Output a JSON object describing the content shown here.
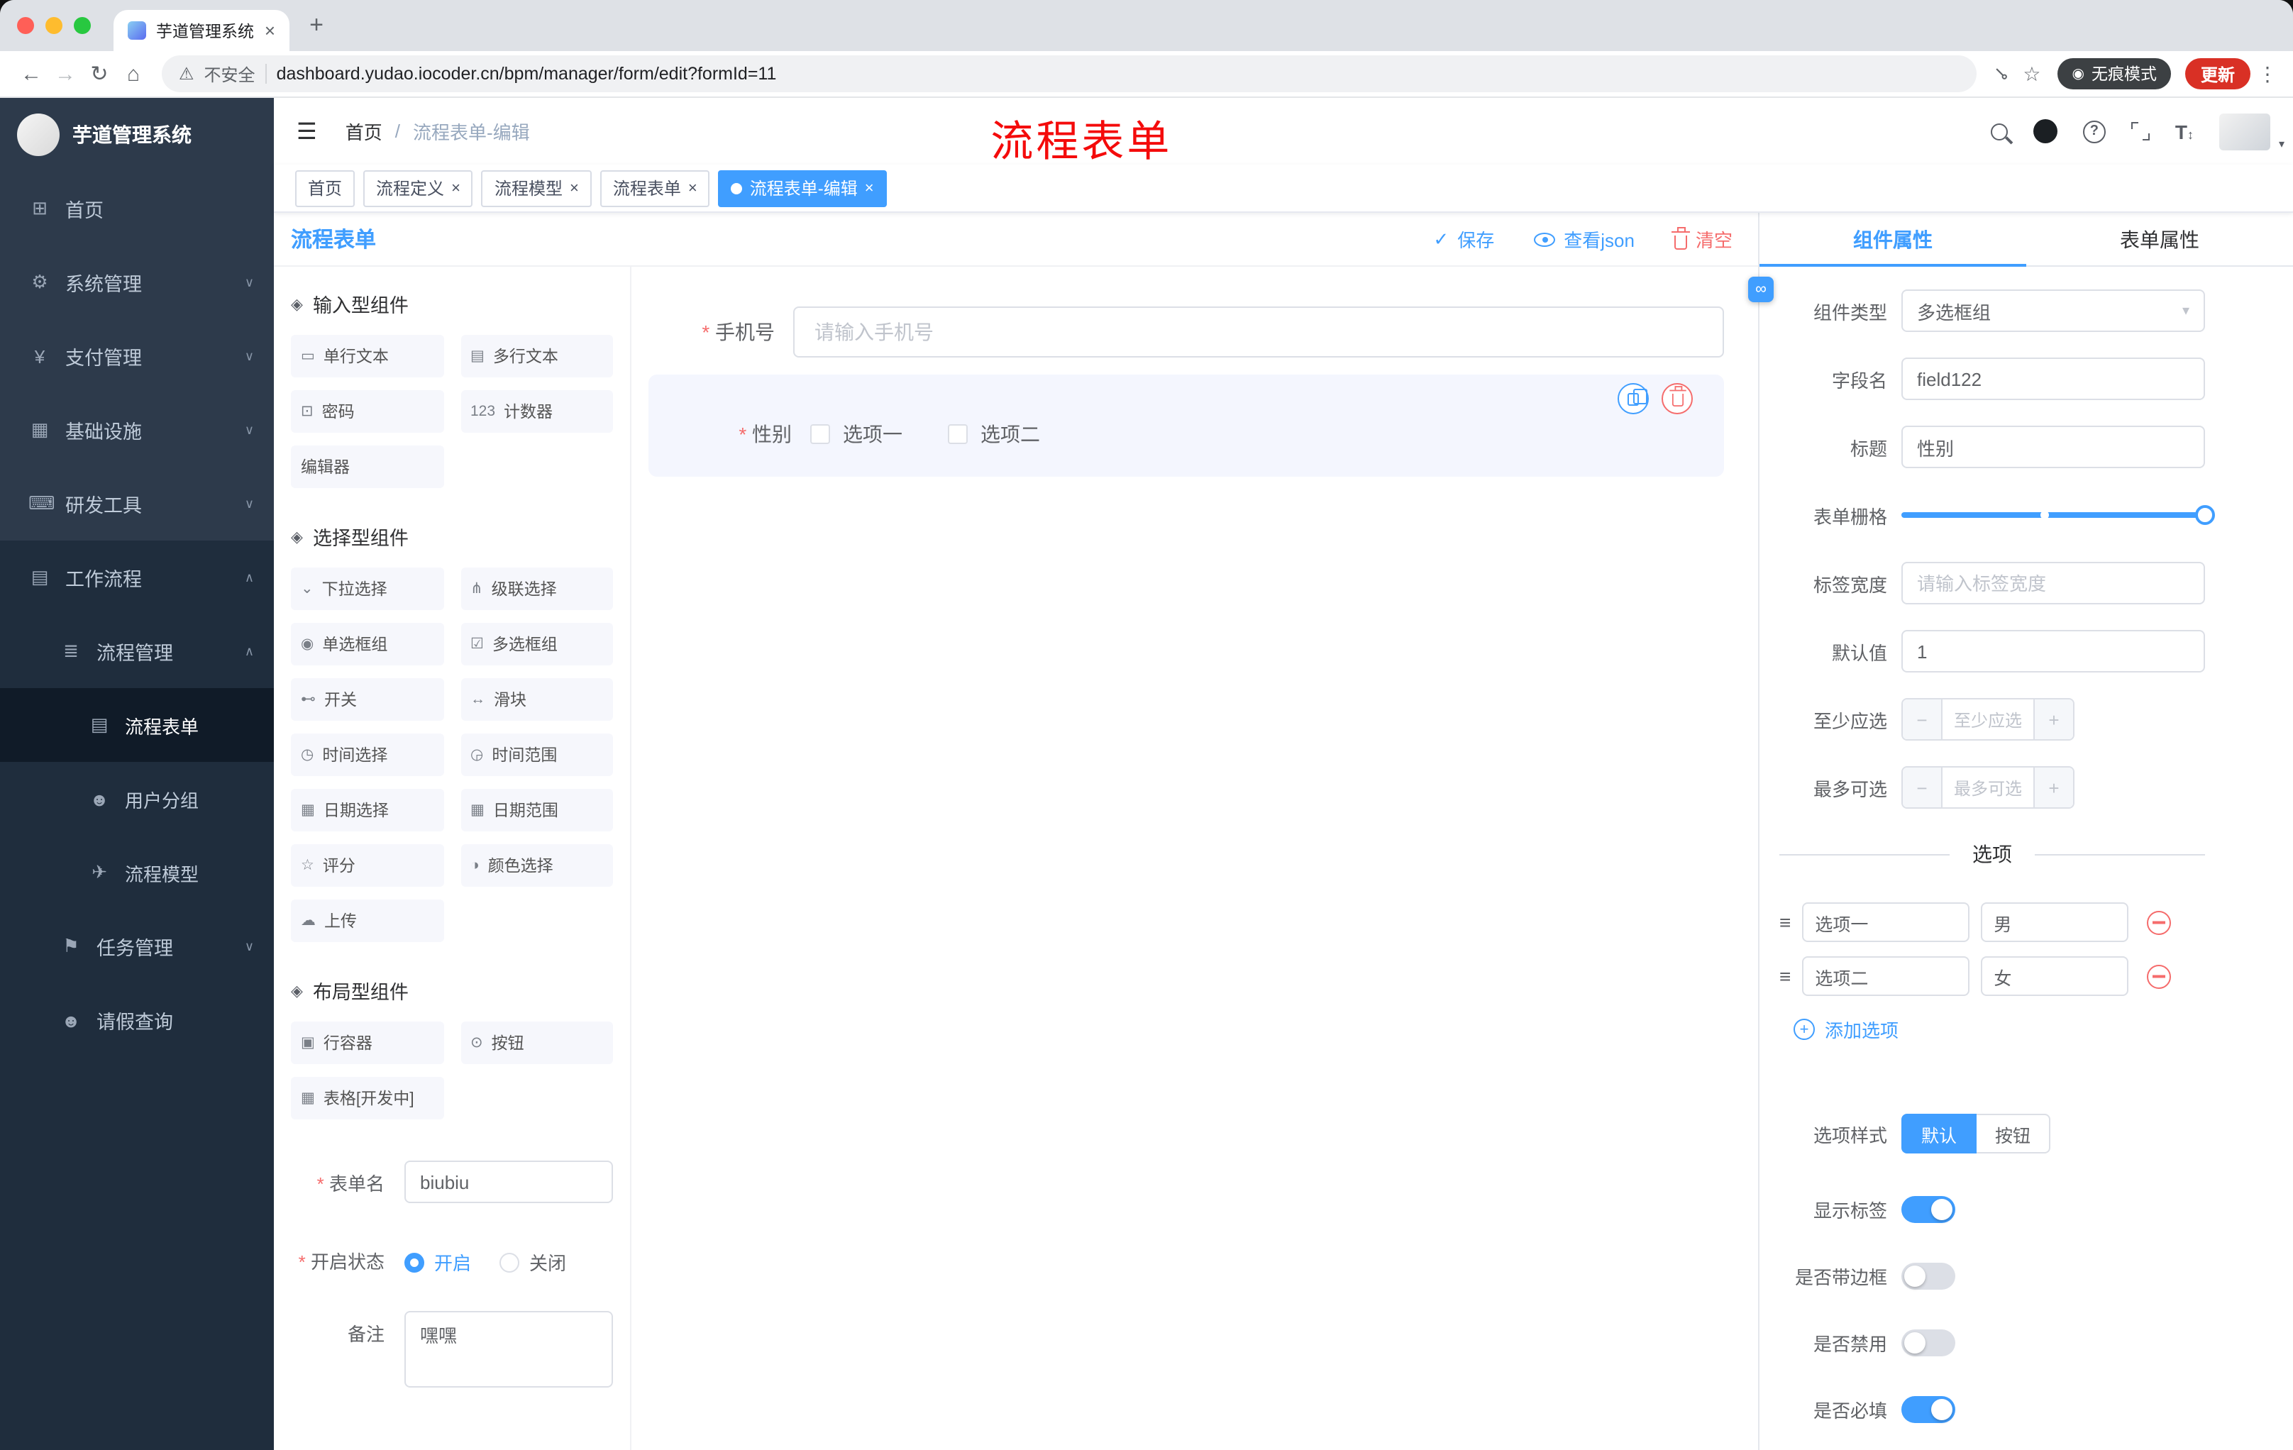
{
  "colors": {
    "accent": "#409eff",
    "danger": "#f56c6c",
    "annotation_red": "#f40b0b",
    "update_red": "#d93025",
    "sidebar_bg": "#2d3a4b",
    "submenu_bg": "#1f2d3d"
  },
  "chrome": {
    "tab_title": "芋道管理系统",
    "security_label": "不安全",
    "url": "dashboard.yudao.iocoder.cn/bpm/manager/form/edit?formId=11",
    "incognito_label": "无痕模式",
    "update_label": "更新"
  },
  "sidebar": {
    "brand": "芋道管理系统",
    "items": [
      {
        "key": "home",
        "label": "首页",
        "icon": "⊞",
        "icon_name": "home-icon",
        "level": 1
      },
      {
        "key": "system",
        "label": "系统管理",
        "icon": "⚙",
        "icon_name": "gear-icon",
        "level": 1,
        "chevron": "down"
      },
      {
        "key": "payment",
        "label": "支付管理",
        "icon": "¥",
        "icon_name": "yen-icon",
        "level": 1,
        "chevron": "down"
      },
      {
        "key": "infra",
        "label": "基础设施",
        "icon": "▦",
        "icon_name": "infrastructure-icon",
        "level": 1,
        "chevron": "down"
      },
      {
        "key": "devtools",
        "label": "研发工具",
        "icon": "⌨",
        "icon_name": "devtools-icon",
        "level": 1,
        "chevron": "down"
      },
      {
        "key": "workflow",
        "label": "工作流程",
        "icon": "▤",
        "icon_name": "workflow-icon",
        "level": 1,
        "chevron": "up",
        "dark": true
      },
      {
        "key": "process-management",
        "label": "流程管理",
        "icon": "≣",
        "icon_name": "process-management-icon",
        "level": 2,
        "chevron": "up",
        "dark": true
      },
      {
        "key": "process-form",
        "label": "流程表单",
        "icon": "▤",
        "icon_name": "process-form-icon",
        "level": 3,
        "dark": true,
        "active": true
      },
      {
        "key": "user-group",
        "label": "用户分组",
        "icon": "☻",
        "icon_name": "user-group-icon",
        "level": 3,
        "dark": true
      },
      {
        "key": "process-model",
        "label": "流程模型",
        "icon": "✈",
        "icon_name": "process-model-icon",
        "level": 3,
        "dark": true
      },
      {
        "key": "task-management",
        "label": "任务管理",
        "icon": "⚑",
        "icon_name": "task-management-icon",
        "level": 2,
        "chevron": "down",
        "dark": true
      },
      {
        "key": "leave-query",
        "label": "请假查询",
        "icon": "☻",
        "icon_name": "person-icon",
        "level": 2,
        "dark": true
      }
    ]
  },
  "header": {
    "breadcrumb_home": "首页",
    "breadcrumb_sep": "/",
    "breadcrumb_current": "流程表单-编辑",
    "annotation": "流程表单"
  },
  "tags": [
    {
      "label": "首页",
      "closable": false,
      "active": false
    },
    {
      "label": "流程定义",
      "closable": true,
      "active": false
    },
    {
      "label": "流程模型",
      "closable": true,
      "active": false
    },
    {
      "label": "流程表单",
      "closable": true,
      "active": false
    },
    {
      "label": "流程表单-编辑",
      "closable": true,
      "active": true
    }
  ],
  "designer": {
    "title": "流程表单",
    "actions": {
      "save": "保存",
      "view_json": "查看json",
      "clear": "清空"
    },
    "palette": [
      {
        "title": "输入型组件",
        "icon": "◈",
        "items": [
          {
            "label": "单行文本",
            "icon": "▭",
            "icon_name": "single-line-text-icon"
          },
          {
            "label": "多行文本",
            "icon": "▤",
            "icon_name": "multi-line-text-icon"
          },
          {
            "label": "密码",
            "icon": "⊡",
            "icon_name": "password-icon"
          },
          {
            "label": "计数器",
            "icon": "123",
            "icon_name": "counter-icon"
          },
          {
            "label": "编辑器",
            "icon": "",
            "icon_name": "editor-icon"
          }
        ]
      },
      {
        "title": "选择型组件",
        "icon": "◈",
        "items": [
          {
            "label": "下拉选择",
            "icon": "⌄",
            "icon_name": "select-icon"
          },
          {
            "label": "级联选择",
            "icon": "⋔",
            "icon_name": "cascader-icon"
          },
          {
            "label": "单选框组",
            "icon": "◉",
            "icon_name": "radio-group-icon"
          },
          {
            "label": "多选框组",
            "icon": "☑",
            "icon_name": "checkbox-group-icon"
          },
          {
            "label": "开关",
            "icon": "⊷",
            "icon_name": "switch-icon"
          },
          {
            "label": "滑块",
            "icon": "↔",
            "icon_name": "slider-icon"
          },
          {
            "label": "时间选择",
            "icon": "◷",
            "icon_name": "time-picker-icon"
          },
          {
            "label": "时间范围",
            "icon": "◶",
            "icon_name": "time-range-icon"
          },
          {
            "label": "日期选择",
            "icon": "▦",
            "icon_name": "date-picker-icon"
          },
          {
            "label": "日期范围",
            "icon": "▦",
            "icon_name": "date-range-icon"
          },
          {
            "label": "评分",
            "icon": "☆",
            "icon_name": "rate-icon"
          },
          {
            "label": "颜色选择",
            "icon": "◑",
            "icon_name": "color-picker-icon"
          },
          {
            "label": "上传",
            "icon": "☁",
            "icon_name": "upload-icon"
          }
        ]
      },
      {
        "title": "布局型组件",
        "icon": "◈",
        "items": [
          {
            "label": "行容器",
            "icon": "▣",
            "icon_name": "row-container-icon"
          },
          {
            "label": "按钮",
            "icon": "⊙",
            "icon_name": "button-icon"
          },
          {
            "label": "表格[开发中]",
            "icon": "▦",
            "icon_name": "table-icon"
          }
        ]
      }
    ],
    "meta": {
      "form_name_label": "表单名",
      "form_name_value": "biubiu",
      "status_label": "开启状态",
      "status_on": "开启",
      "status_off": "关闭",
      "remark_label": "备注",
      "remark_value": "嘿嘿"
    }
  },
  "canvas": {
    "phone": {
      "label": "手机号",
      "placeholder": "请输入手机号"
    },
    "gender": {
      "label": "性别",
      "options": [
        "选项一",
        "选项二"
      ]
    }
  },
  "inspector": {
    "tabs": [
      "组件属性",
      "表单属性"
    ],
    "fields": {
      "component_type_label": "组件类型",
      "component_type_value": "多选框组",
      "field_name_label": "字段名",
      "field_name_value": "field122",
      "title_label": "标题",
      "title_value": "性别",
      "grid_label": "表单栅格",
      "label_width_label": "标签宽度",
      "label_width_placeholder": "请输入标签宽度",
      "default_label": "默认值",
      "default_value": "1",
      "min_label": "至少应选",
      "min_placeholder": "至少应选",
      "max_label": "最多可选",
      "max_placeholder": "最多可选"
    },
    "options": {
      "divider": "选项",
      "rows": [
        {
          "name": "选项一",
          "value": "男"
        },
        {
          "name": "选项二",
          "value": "女"
        }
      ],
      "add_label": "添加选项"
    },
    "style": {
      "label": "选项样式",
      "options": [
        "默认",
        "按钮"
      ],
      "selected": "默认"
    },
    "switches": [
      {
        "label": "显示标签",
        "on": true
      },
      {
        "label": "是否带边框",
        "on": false
      },
      {
        "label": "是否禁用",
        "on": false
      },
      {
        "label": "是否必填",
        "on": true
      }
    ]
  }
}
